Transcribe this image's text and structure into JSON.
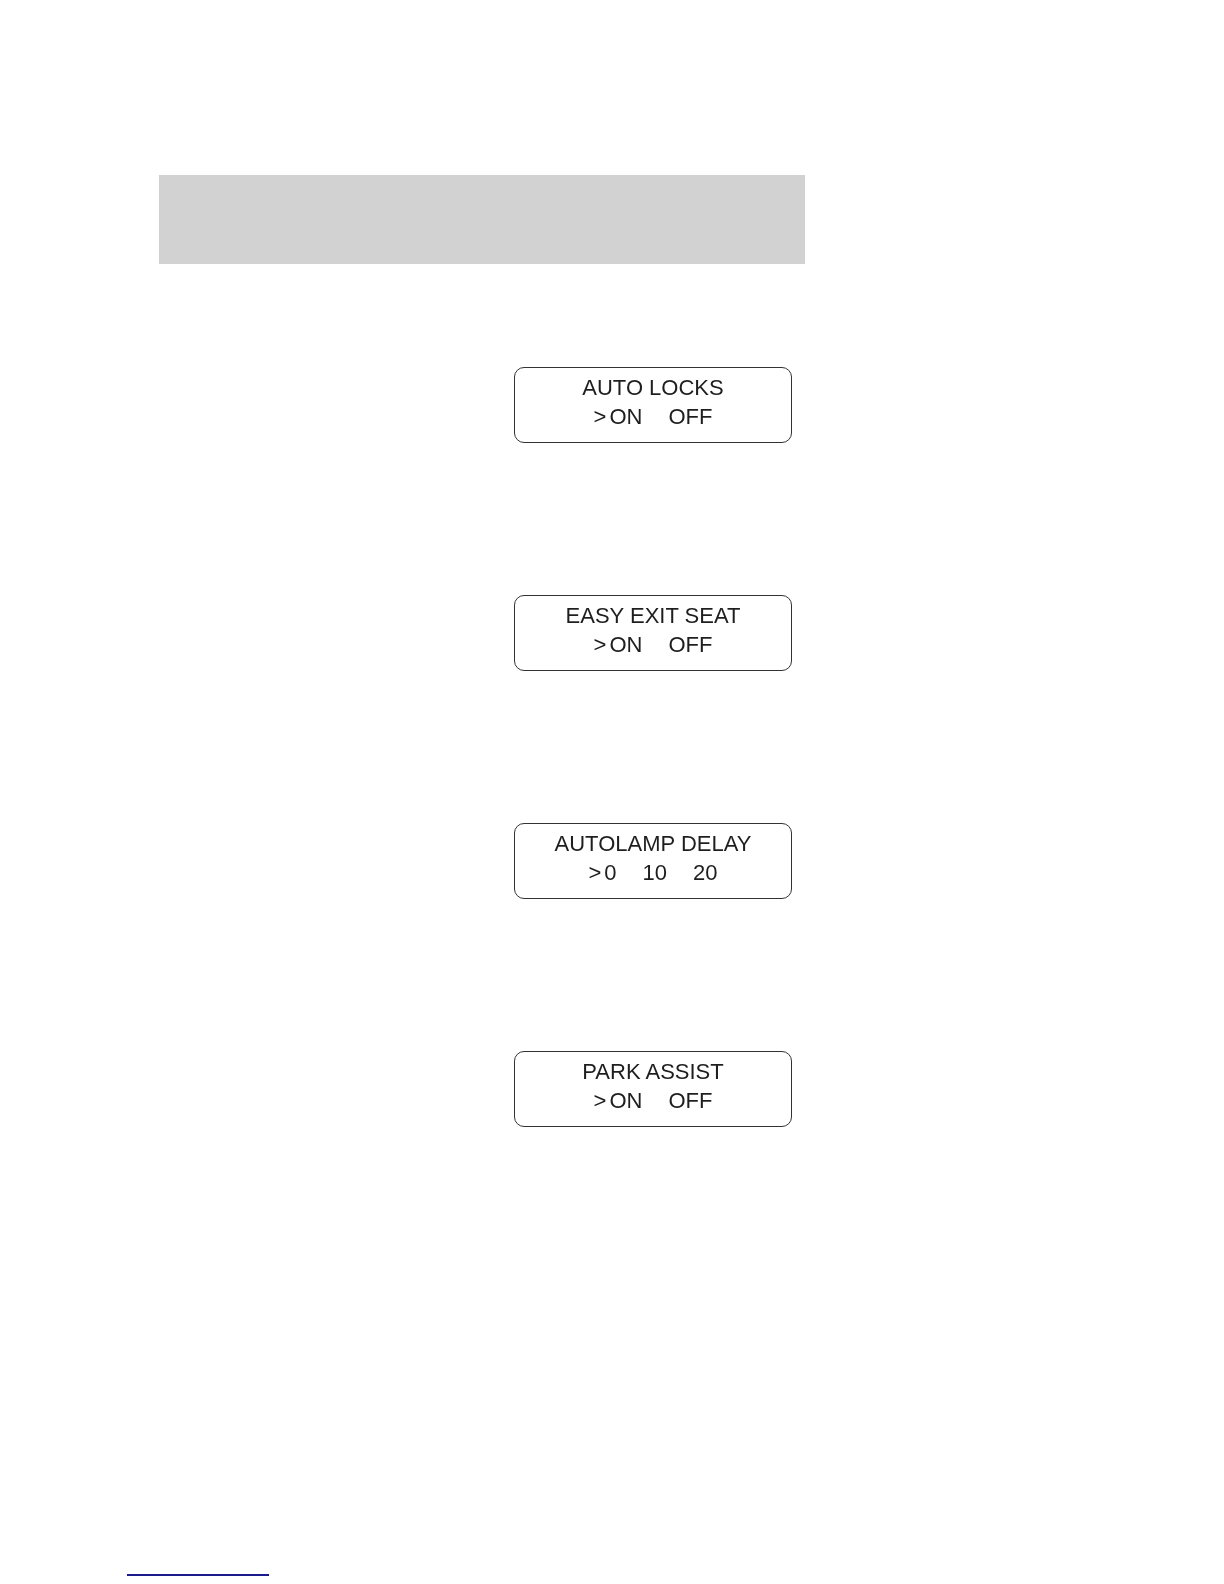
{
  "displays": [
    {
      "title": "AUTO LOCKS",
      "cursor": ">",
      "options": [
        {
          "label": "ON",
          "selected": true
        },
        {
          "label": "OFF",
          "selected": false
        }
      ]
    },
    {
      "title": "EASY EXIT SEAT",
      "cursor": ">",
      "options": [
        {
          "label": "ON",
          "selected": true
        },
        {
          "label": "OFF",
          "selected": false
        }
      ]
    },
    {
      "title": "AUTOLAMP DELAY",
      "cursor": ">",
      "options": [
        {
          "label": "0",
          "selected": true
        },
        {
          "label": "10",
          "selected": false
        },
        {
          "label": "20",
          "selected": false
        }
      ]
    },
    {
      "title": "PARK ASSIST",
      "cursor": ">",
      "options": [
        {
          "label": "ON",
          "selected": true
        },
        {
          "label": "OFF",
          "selected": false
        }
      ]
    }
  ]
}
